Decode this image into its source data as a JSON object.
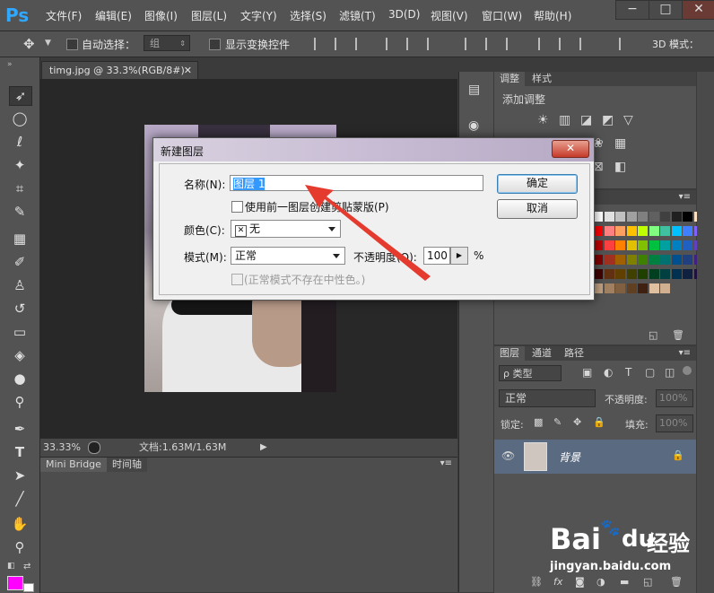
{
  "app": {
    "logo": "Ps"
  },
  "menu": [
    "文件(F)",
    "编辑(E)",
    "图像(I)",
    "图层(L)",
    "文字(Y)",
    "选择(S)",
    "滤镜(T)",
    "3D(D)",
    "视图(V)",
    "窗口(W)",
    "帮助(H)"
  ],
  "window_controls": {
    "minimize": "−",
    "maximize": "□",
    "close": "✕"
  },
  "options": {
    "auto_select_label": "自动选择：",
    "auto_select_value": "组",
    "show_transform_label": "显示变换控件",
    "mode_3d_label": "3D 模式："
  },
  "document": {
    "tab_title": "timg.jpg @ 33.3%(RGB/8#)",
    "zoom": "33.33%",
    "doc_info": "文档:1.63M/1.63M"
  },
  "bottom_tabs": [
    "Mini Bridge",
    "时间轴"
  ],
  "adjust_panel": {
    "tabs": [
      "调整",
      "样式"
    ],
    "subtitle": "添加调整"
  },
  "layers_panel": {
    "tabs": [
      "图层",
      "通道",
      "路径"
    ],
    "filter_label": "ρ 类型",
    "blend_mode": "正常",
    "opacity_label": "不透明度:",
    "opacity_value": "100%",
    "lock_label": "锁定:",
    "fill_label": "填充:",
    "fill_value": "100%",
    "layer_name": "背景"
  },
  "dialog": {
    "title": "新建图层",
    "close": "✕",
    "name_label": "名称(N):",
    "name_value": "图层 1",
    "clip_label": "使用前一图层创建剪贴蒙版(P)",
    "color_label": "颜色(C):",
    "color_value": "无",
    "mode_label": "模式(M):",
    "mode_value": "正常",
    "opacity_label": "不透明度(O):",
    "opacity_value": "100",
    "opacity_unit": "%",
    "neutral_label": "(正常模式不存在中性色。)",
    "ok_label": "确定",
    "cancel_label": "取消"
  },
  "watermark": {
    "brand": "Bai",
    "brand2": "du",
    "suffix": "经验",
    "url": "jingyan.baidu.com"
  },
  "colors": {
    "accent": "#31a8ff",
    "foreground_swatch": "#ff00ff",
    "arrow": "#e53a2e",
    "layer_selected": "#5a6a80"
  }
}
